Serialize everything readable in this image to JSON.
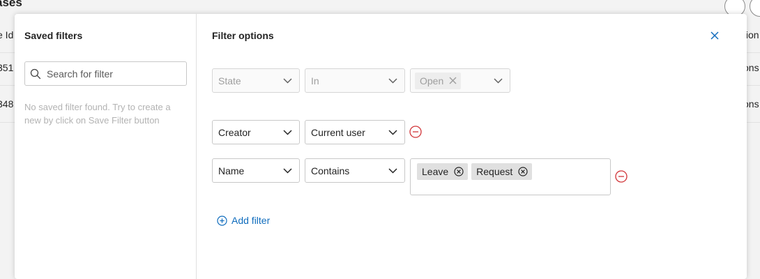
{
  "background": {
    "title": "ases",
    "left_header": "e Id",
    "right_header": "tion",
    "rows": [
      {
        "left": "351",
        "right": "ons"
      },
      {
        "left": "348",
        "right": "ons"
      }
    ]
  },
  "dialog": {
    "saved_filters": {
      "title": "Saved filters",
      "search_placeholder": "Search for filter",
      "empty_message": "No saved filter found. Try to create a new by click on Save Filter button"
    },
    "filter_options": {
      "title": "Filter options",
      "rows": [
        {
          "field": "State",
          "operator": "In",
          "values": [
            "Open"
          ],
          "disabled": true
        },
        {
          "field": "Creator",
          "operator": "Current user",
          "values": []
        },
        {
          "field": "Name",
          "operator": "Contains",
          "values": [
            "Leave",
            "Request"
          ]
        }
      ],
      "add_filter_label": "Add filter"
    }
  },
  "colors": {
    "accent": "#0f6cbd",
    "danger": "#d13438",
    "disabled_text": "#9e9e9e"
  },
  "icons": {
    "search": "search-icon",
    "close": "close-icon",
    "chevron": "chevron-down-icon",
    "chip_remove": "dismiss-circle-icon",
    "row_remove": "remove-circle-icon",
    "add": "add-circle-icon"
  }
}
